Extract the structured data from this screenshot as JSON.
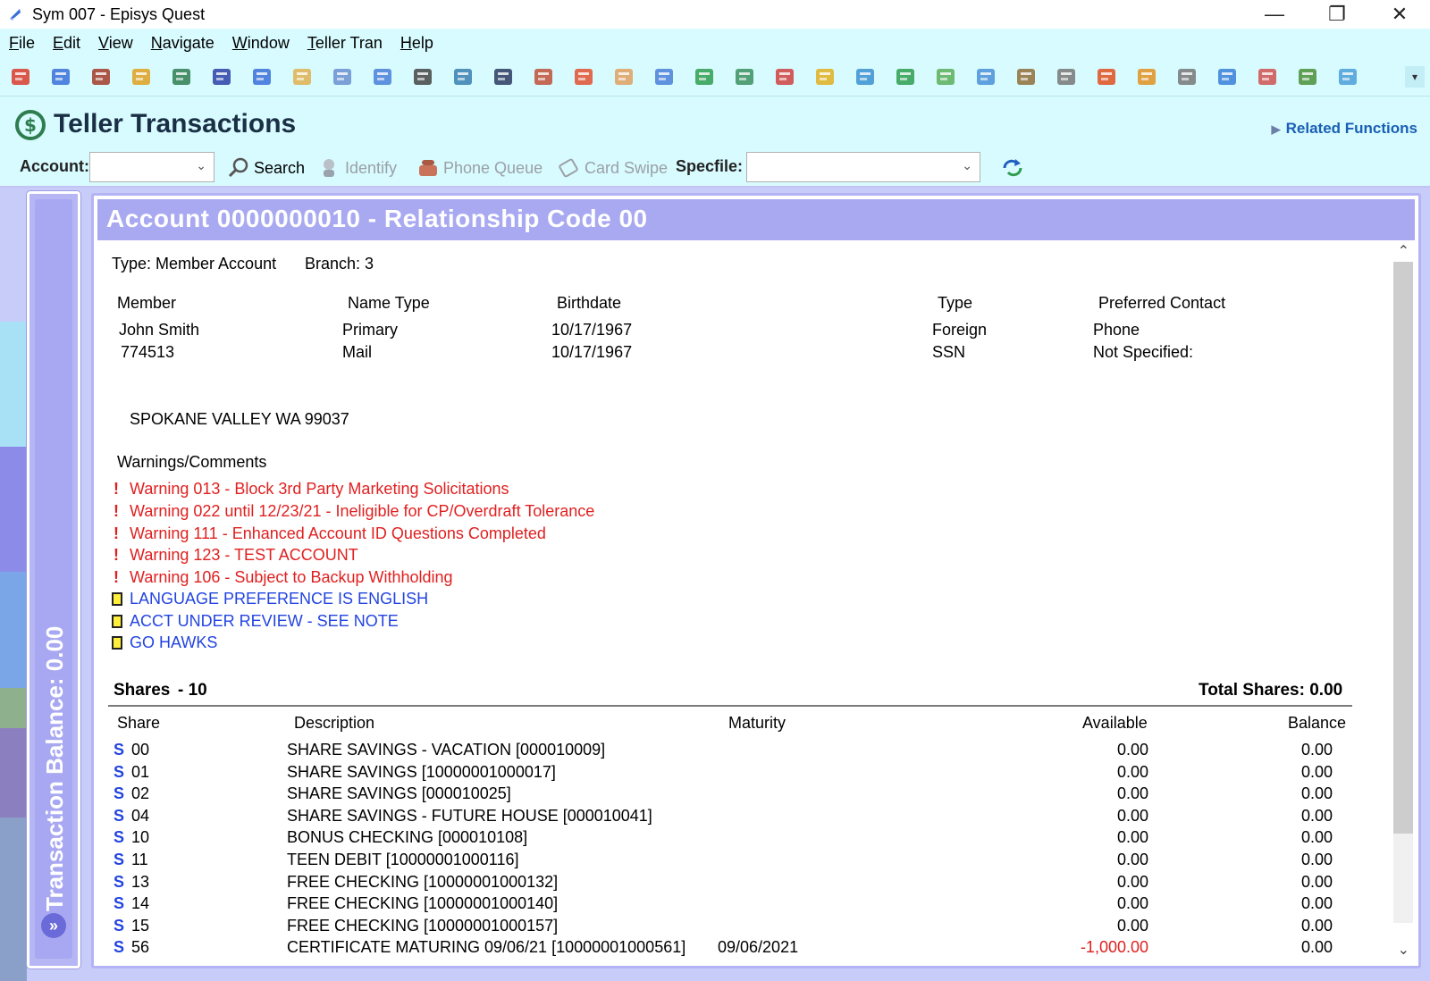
{
  "window": {
    "title": "Sym 007 - Episys Quest",
    "minimize": "—",
    "restore": "❐",
    "close": "✕"
  },
  "menu": [
    "File",
    "Edit",
    "View",
    "Navigate",
    "Window",
    "Teller Tran",
    "Help"
  ],
  "toolbar_icons": [
    "back-arrow",
    "members",
    "lock",
    "edit",
    "person-house",
    "home",
    "notes",
    "award",
    "document",
    "copy",
    "calendar",
    "network",
    "monitor",
    "tools",
    "cards",
    "gear-cd",
    "forms",
    "computer",
    "tasks",
    "cycle",
    "folder-red",
    "chart-a",
    "chart-b",
    "question",
    "cube",
    "report",
    "card",
    "person-red",
    "mail",
    "settings",
    "globe",
    "people",
    "money",
    "display"
  ],
  "teller": {
    "heading": "Teller Transactions",
    "related": "Related Functions"
  },
  "acctbar": {
    "account_label": "Account:",
    "account_value": "",
    "search": "Search",
    "identify": "Identify",
    "phone_queue": "Phone Queue",
    "card_swipe": "Card Swipe",
    "specfile_label": "Specfile:",
    "specfile_value": ""
  },
  "sidebar": {
    "label": "Transaction Balance: 0.00",
    "expand": "»"
  },
  "account": {
    "title": "Account 0000000010  -  Relationship Code 00",
    "type": "Type: Member Account",
    "branch": "Branch: 3",
    "headers": {
      "member": "Member",
      "name_type": "Name Type",
      "birthdate": "Birthdate",
      "type": "Type",
      "preferred": "Preferred Contact"
    },
    "rows": [
      {
        "member": "John Smith",
        "name_type": "Primary",
        "birthdate": "10/17/1967",
        "type": "Foreign",
        "preferred": "Phone"
      },
      {
        "member": "774513",
        "name_type": "Mail",
        "birthdate": "10/17/1967",
        "type": "SSN",
        "preferred": "Not Specified:"
      }
    ],
    "address": "SPOKANE VALLEY WA 99037"
  },
  "warnings": {
    "heading": "Warnings/Comments",
    "items": [
      "Warning 013 - Block 3rd Party Marketing Solicitations",
      "Warning 022 until 12/23/21 - Ineligible for CP/Overdraft Tolerance",
      "Warning 111 - Enhanced Account ID Questions Completed",
      "Warning 123 - TEST ACCOUNT",
      "Warning 106 - Subject to Backup Withholding"
    ],
    "notes": [
      "LANGUAGE PREFERENCE IS ENGLISH",
      "ACCT UNDER REVIEW - SEE NOTE",
      "GO HAWKS"
    ]
  },
  "shares": {
    "heading": "Shares",
    "count": "- 10",
    "total": "Total Shares: 0.00",
    "columns": {
      "share": "Share",
      "description": "Description",
      "maturity": "Maturity",
      "available": "Available",
      "balance": "Balance"
    },
    "marker": "S",
    "rows": [
      {
        "id": "00",
        "description": "SHARE SAVINGS - VACATION [000010009]",
        "maturity": "",
        "available": "0.00",
        "balance": "0.00"
      },
      {
        "id": "01",
        "description": "SHARE SAVINGS [10000001000017]",
        "maturity": "",
        "available": "0.00",
        "balance": "0.00"
      },
      {
        "id": "02",
        "description": "SHARE SAVINGS [000010025]",
        "maturity": "",
        "available": "0.00",
        "balance": "0.00"
      },
      {
        "id": "04",
        "description": "SHARE SAVINGS - FUTURE HOUSE [000010041]",
        "maturity": "",
        "available": "0.00",
        "balance": "0.00"
      },
      {
        "id": "10",
        "description": "BONUS CHECKING [000010108]",
        "maturity": "",
        "available": "0.00",
        "balance": "0.00"
      },
      {
        "id": "11",
        "description": "TEEN DEBIT [10000001000116]",
        "maturity": "",
        "available": "0.00",
        "balance": "0.00"
      },
      {
        "id": "13",
        "description": "FREE CHECKING [10000001000132]",
        "maturity": "",
        "available": "0.00",
        "balance": "0.00"
      },
      {
        "id": "14",
        "description": "FREE CHECKING [10000001000140]",
        "maturity": "",
        "available": "0.00",
        "balance": "0.00"
      },
      {
        "id": "15",
        "description": "FREE CHECKING [10000001000157]",
        "maturity": "",
        "available": "0.00",
        "balance": "0.00"
      },
      {
        "id": "56",
        "description": "CERTIFICATE MATURING 09/06/21 [10000001000561]",
        "maturity": "09/06/2021",
        "available": "-1,000.00",
        "balance": "0.00"
      }
    ]
  },
  "colors": {
    "menu_bg": "#d8fbff",
    "panel_header": "#a9a9f2",
    "warning": "#e02020",
    "note": "#2244e0"
  }
}
